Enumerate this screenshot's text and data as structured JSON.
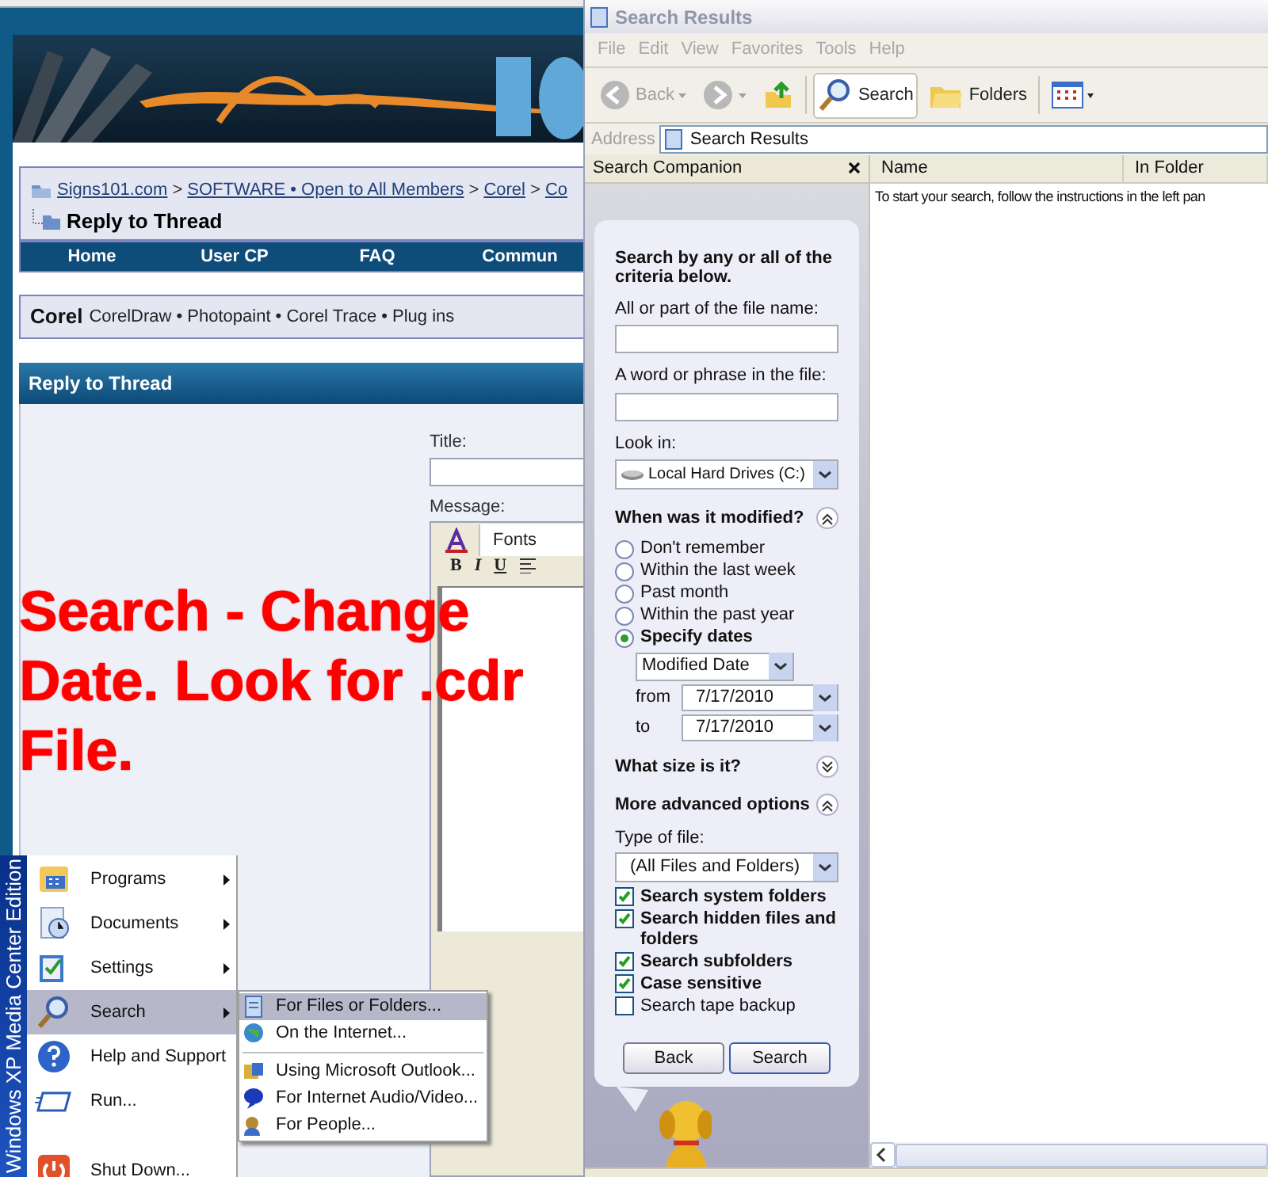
{
  "browser_page": {
    "breadcrumb": {
      "separator": ">",
      "links": [
        "Signs101.com",
        "SOFTWARE • Open to All Members",
        "Corel",
        "Co"
      ],
      "current": "Reply to Thread"
    },
    "nav": [
      "Home",
      "User CP",
      "FAQ",
      "Commun"
    ],
    "forum": {
      "title": "Corel",
      "subforums": "CorelDraw • Photopaint • Corel Trace • Plug ins"
    },
    "section_title": "Reply to Thread",
    "form": {
      "title_label": "Title:",
      "message_label": "Message:",
      "font_select": "Fonts",
      "format_buttons": [
        "B",
        "I",
        "U"
      ]
    }
  },
  "annotation": [
    "Search - Change",
    "Date. Look for .cdr",
    "File."
  ],
  "start_menu": {
    "edition": "Windows XP Media Center Edition",
    "items": [
      {
        "kind": "programs",
        "label": "Programs",
        "submenu": true,
        "selected": false
      },
      {
        "kind": "documents",
        "label": "Documents",
        "submenu": true,
        "selected": false
      },
      {
        "kind": "settings",
        "label": "Settings",
        "submenu": true,
        "selected": false
      },
      {
        "kind": "search",
        "label": "Search",
        "submenu": true,
        "selected": true
      },
      {
        "kind": "help",
        "label": "Help and Support",
        "submenu": false,
        "selected": false
      },
      {
        "kind": "run",
        "label": "Run...",
        "submenu": false,
        "selected": false
      },
      {
        "kind": "separator"
      },
      {
        "kind": "shutdown",
        "label": "Shut Down...",
        "submenu": false,
        "selected": false
      }
    ],
    "submenu": [
      {
        "kind": "files",
        "label": "For Files or Folders...",
        "selected": true
      },
      {
        "kind": "internet",
        "label": "On the Internet...",
        "selected": false
      },
      {
        "kind": "separator"
      },
      {
        "kind": "outlook",
        "label": "Using Microsoft Outlook...",
        "selected": false
      },
      {
        "kind": "media",
        "label": "For Internet Audio/Video...",
        "selected": false
      },
      {
        "kind": "people",
        "label": "For People...",
        "selected": false
      }
    ]
  },
  "explorer": {
    "title": "Search Results",
    "menu": [
      "File",
      "Edit",
      "View",
      "Favorites",
      "Tools",
      "Help"
    ],
    "toolbar": [
      {
        "kind": "back",
        "label": "Back",
        "selected": false
      },
      {
        "kind": "forward",
        "selected": false
      },
      {
        "kind": "up",
        "selected": false
      },
      {
        "kind": "search",
        "label": "Search",
        "selected": true
      },
      {
        "kind": "folders",
        "label": "Folders",
        "selected": false
      },
      {
        "kind": "views",
        "selected": false
      }
    ],
    "address_label": "Address",
    "address": "Search Results",
    "pane_title": "Search Companion",
    "columns": [
      "Name",
      "In Folder"
    ],
    "message": "To start your search, follow the instructions in the left pan",
    "companion": {
      "heading": "Search by any or all of the criteria below.",
      "fields": [
        {
          "label": "All or part of the file name:"
        },
        {
          "label": "A word or phrase in the file:"
        }
      ],
      "look_in": {
        "label": "Look in:",
        "value": "Local Hard Drives (C:)"
      },
      "modified": {
        "title": "When was it modified?",
        "expanded": true,
        "options": [
          {
            "label": "Don't remember",
            "selected": false
          },
          {
            "label": "Within the last week",
            "selected": false
          },
          {
            "label": "Past month",
            "selected": false
          },
          {
            "label": "Within the past year",
            "selected": false
          },
          {
            "label": "Specify dates",
            "selected": true
          }
        ],
        "date_type": "Modified Date",
        "from_label": "from",
        "from": "7/17/2010",
        "to_label": "to",
        "to": "7/17/2010"
      },
      "size": {
        "title": "What size is it?",
        "expanded": false
      },
      "advanced": {
        "title": "More advanced options",
        "expanded": true,
        "type_label": "Type of file:",
        "type": "(All Files and Folders)",
        "options": [
          {
            "label": "Search system folders",
            "checked": true
          },
          {
            "label": "Search hidden files and folders",
            "checked": true
          },
          {
            "label": "Search subfolders",
            "checked": true
          },
          {
            "label": "Case sensitive",
            "checked": true
          },
          {
            "label": "Search tape backup",
            "checked": false
          }
        ]
      },
      "buttons": [
        "Back",
        "Search"
      ]
    }
  }
}
